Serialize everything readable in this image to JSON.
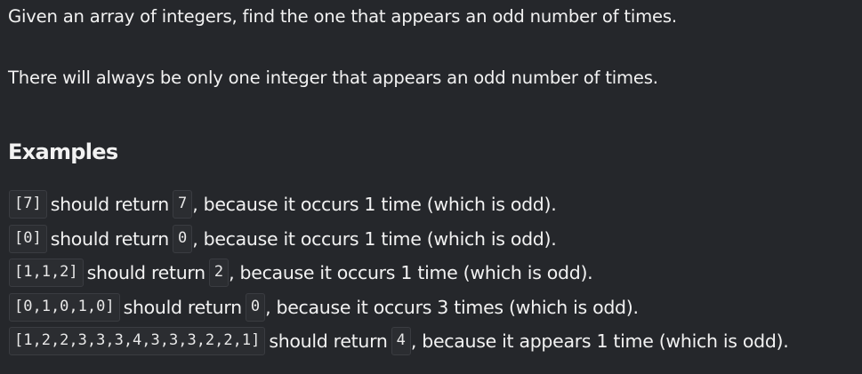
{
  "description": {
    "line1": "Given an array of integers, find the one that appears an odd number of times.",
    "line2": "There will always be only one integer that appears an odd number of times."
  },
  "examples_heading": "Examples",
  "examples": [
    {
      "input": "[7]",
      "mid": "should return",
      "output": "7",
      "after": ", because it occurs 1 time (which is odd)."
    },
    {
      "input": "[0]",
      "mid": "should return",
      "output": "0",
      "after": ", because it occurs 1 time (which is odd)."
    },
    {
      "input": "[1,1,2]",
      "mid": "should return",
      "output": "2",
      "after": ", because it occurs 1 time (which is odd)."
    },
    {
      "input": "[0,1,0,1,0]",
      "mid": "should return",
      "output": "0",
      "after": ", because it occurs 3 times (which is odd)."
    },
    {
      "input": "[1,2,2,3,3,3,4,3,3,3,2,2,1]",
      "mid": "should return",
      "output": "4",
      "after": ", because it appears 1 time (which is odd)."
    }
  ]
}
